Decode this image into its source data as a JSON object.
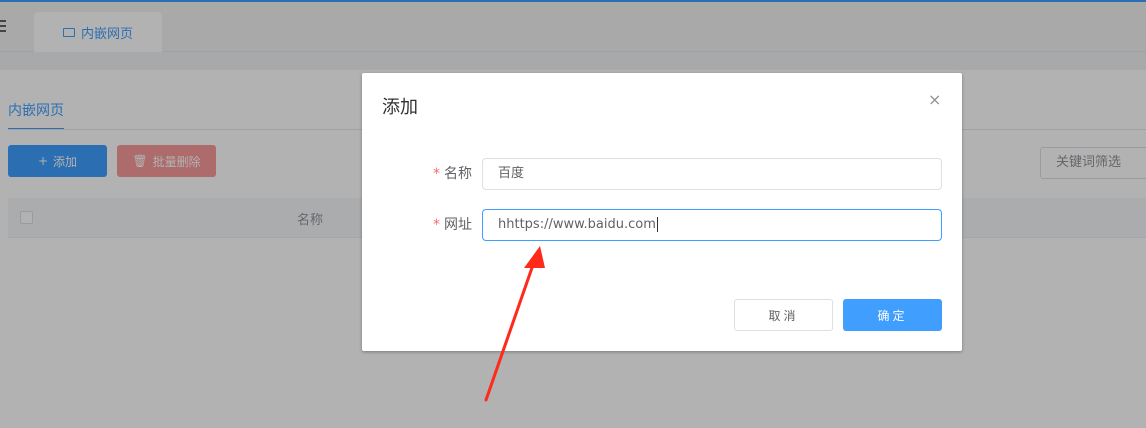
{
  "page": {
    "tab_label": "内嵌网页",
    "sub_tab_label": "内嵌网页",
    "add_button_label": "添加",
    "batch_delete_label": "批量删除",
    "keyword_placeholder": "关键词筛选",
    "table_column_name": "名称"
  },
  "dialog": {
    "title": "添加",
    "close_symbol": "×",
    "fields": [
      {
        "label": "名称",
        "required_mark": "*",
        "value": "百度"
      },
      {
        "label": "网址",
        "required_mark": "*",
        "value": "hhttps://www.baidu.com"
      }
    ],
    "cancel_label": "取消",
    "confirm_label": "确定"
  },
  "colors": {
    "primary": "#409eff",
    "danger": "#f78989",
    "required": "#f56c6c",
    "annotation_arrow": "#ff2a1a"
  }
}
